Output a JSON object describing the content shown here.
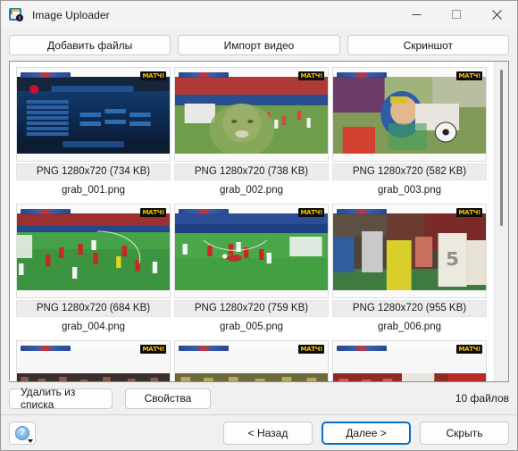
{
  "window": {
    "title": "Image Uploader",
    "app_icon": "image-uploader-icon",
    "controls": {
      "minimize": "minimize-icon",
      "maximize": "maximize-icon",
      "close": "close-icon"
    }
  },
  "toolbar": {
    "buttons": [
      {
        "label": "Добавить файлы",
        "name": "add-files-button"
      },
      {
        "label": "Импорт видео",
        "name": "import-video-button"
      },
      {
        "label": "Скриншот",
        "name": "screenshot-button"
      }
    ]
  },
  "file_list": {
    "items": [
      {
        "meta": "PNG 1280x720 (734 KB)",
        "filename": "grab_001.png",
        "scene": "lineup"
      },
      {
        "meta": "PNG 1280x720 (738 KB)",
        "filename": "grab_002.png",
        "scene": "player-closeup"
      },
      {
        "meta": "PNG 1280x720 (582 KB)",
        "filename": "grab_003.png",
        "scene": "ball-duel"
      },
      {
        "meta": "PNG 1280x720 (684 KB)",
        "filename": "grab_004.png",
        "scene": "pitch-wide"
      },
      {
        "meta": "PNG 1280x720 (759 KB)",
        "filename": "grab_005.png",
        "scene": "pitch-attack"
      },
      {
        "meta": "PNG 1280x720 (955 KB)",
        "filename": "grab_006.png",
        "scene": "crowd-players"
      },
      {
        "meta": "",
        "filename": "",
        "scene": "crowd-dark"
      },
      {
        "meta": "",
        "filename": "",
        "scene": "crowd-bright"
      },
      {
        "meta": "",
        "filename": "",
        "scene": "crowd-red"
      }
    ],
    "broadcast_logo": "МАТЧ!"
  },
  "statusbar": {
    "remove_label": "Удалить из списка",
    "properties_label": "Свойства",
    "file_count": "10 файлов"
  },
  "footer": {
    "help_glyph": "?",
    "back_label": "< Назад",
    "next_label": "Далее >",
    "hide_label": "Скрыть"
  },
  "colors": {
    "accent": "#0d6fc4",
    "window_bg": "#f0f0f0",
    "panel_bg": "#ffffff",
    "logo_yellow": "#f2c200"
  }
}
